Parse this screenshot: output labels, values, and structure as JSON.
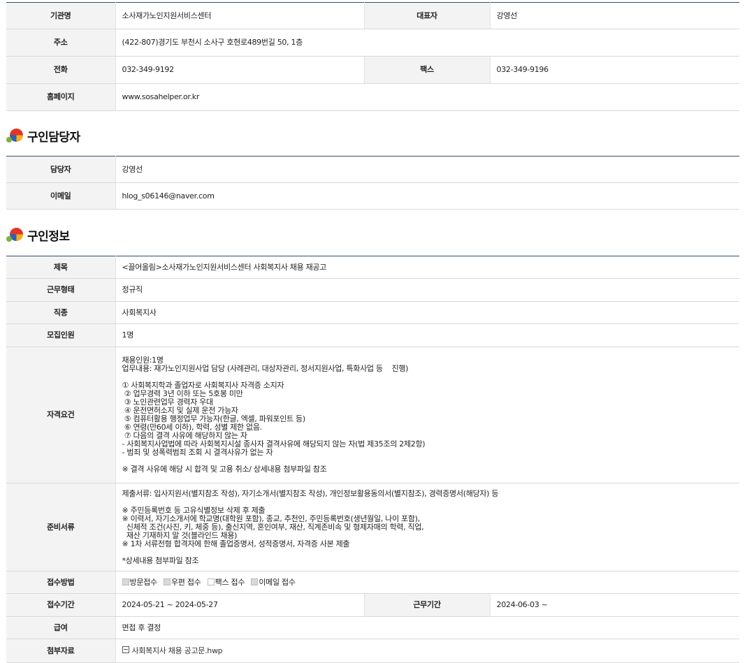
{
  "org": {
    "name_label": "기관명",
    "name": "소사재가노인지원서비스센터",
    "rep_label": "대표자",
    "rep": "강영선",
    "address_label": "주소",
    "address": "(422-807)경기도 부천시 소사구 호현로489번길 50, 1층",
    "phone_label": "전화",
    "phone": "032-349-9192",
    "fax_label": "팩스",
    "fax": "032-349-9196",
    "homepage_label": "홈페이지",
    "homepage": "www.sosahelper.or.kr"
  },
  "contact": {
    "title": "구인담당자",
    "manager_label": "담당자",
    "manager": "강영선",
    "email_label": "이메일",
    "email": "hlog_s06146@naver.com"
  },
  "job": {
    "title": "구인정보",
    "subject_label": "제목",
    "subject": "<끌어올림>소사재가노인지원서비스센터 사회복지사 채용 재공고",
    "work_type_label": "근무형태",
    "work_type": "정규직",
    "occupation_label": "직종",
    "occupation": "사회복지사",
    "headcount_label": "모집인원",
    "headcount": "1명",
    "qualification_label": "자격요건",
    "qualification": "채용인원:1명\n업무내용: 재가노인지원사업 담당 (사례관리, 대상자관리, 정서지원사업, 특화사업 등    진행)\n\n① 사회복지학과 졸업자로 사회복지사 자격증 소지자\n ② 업무경력 3년 이하 또는 5호봉 미만\n ③ 노인관련업무 경력자 우대\n ④ 운전면허소지 및 실제 운전 가능자\n ⑤ 컴퓨터활용 행정업무 가능자(한글, 엑셀, 파워포인트 등)\n ⑥ 연령(만60세 이하), 학력, 성별 제한 없음.\n ⑦ 다음의 결격 사유에 해당하지 않는 자\n- 사회복지사업법에 따라 사회복지시설 종사자 결격사유에 해당되지 않는 자(법 제35조의 2제2항)\n- 범죄 및 성폭력범죄 조회 시 결격사유가 없는 자\n\n※ 결격 사유에 해당 시 합격 및 고용 취소/ 상세내용 첨부파일 참조",
    "documents_label": "준비서류",
    "documents": "제출서류: 입사지원서(별지참조 작성), 자기소개서(별지참조 작성), 개인정보활용동의서(별지참조), 경력증명서(해당자) 등\n\n※ 주민등록번호 등 고유식별정보 삭제 후 제출\n※ 이력서, 자기소개서에 학교명(대학원 포함), 종교, 추천인, 주민등록번호(생년월일, 나이 포함),\n  신체적 조건(사진, 키, 체중 등), 출신지역, 혼인여부, 재산, 직계존비속 및 형제자매의 학력, 직업,\n  재산 기재하지 말 것(블라인드 채용)\n※ 1차 서류전형 합격자에 한해 졸업증명서, 성적증명서, 자격증 사본 제출\n\n*상세내용 첨부파일 참조",
    "method_label": "접수방법",
    "methods": [
      {
        "label": "방문접수",
        "checked": true
      },
      {
        "label": "우편 접수",
        "checked": true
      },
      {
        "label": "팩스 접수",
        "checked": false
      },
      {
        "label": "이메일 접수",
        "checked": true
      }
    ],
    "period_label": "접수기간",
    "period": "2024-05-21 ~ 2024-05-27",
    "work_period_label": "근무기간",
    "work_period": "2024-06-03 ~",
    "salary_label": "급여",
    "salary": "면접 후 결정",
    "attachment_label": "첨부자료",
    "attachment": "사회복지사 채용 공고문.hwp"
  }
}
